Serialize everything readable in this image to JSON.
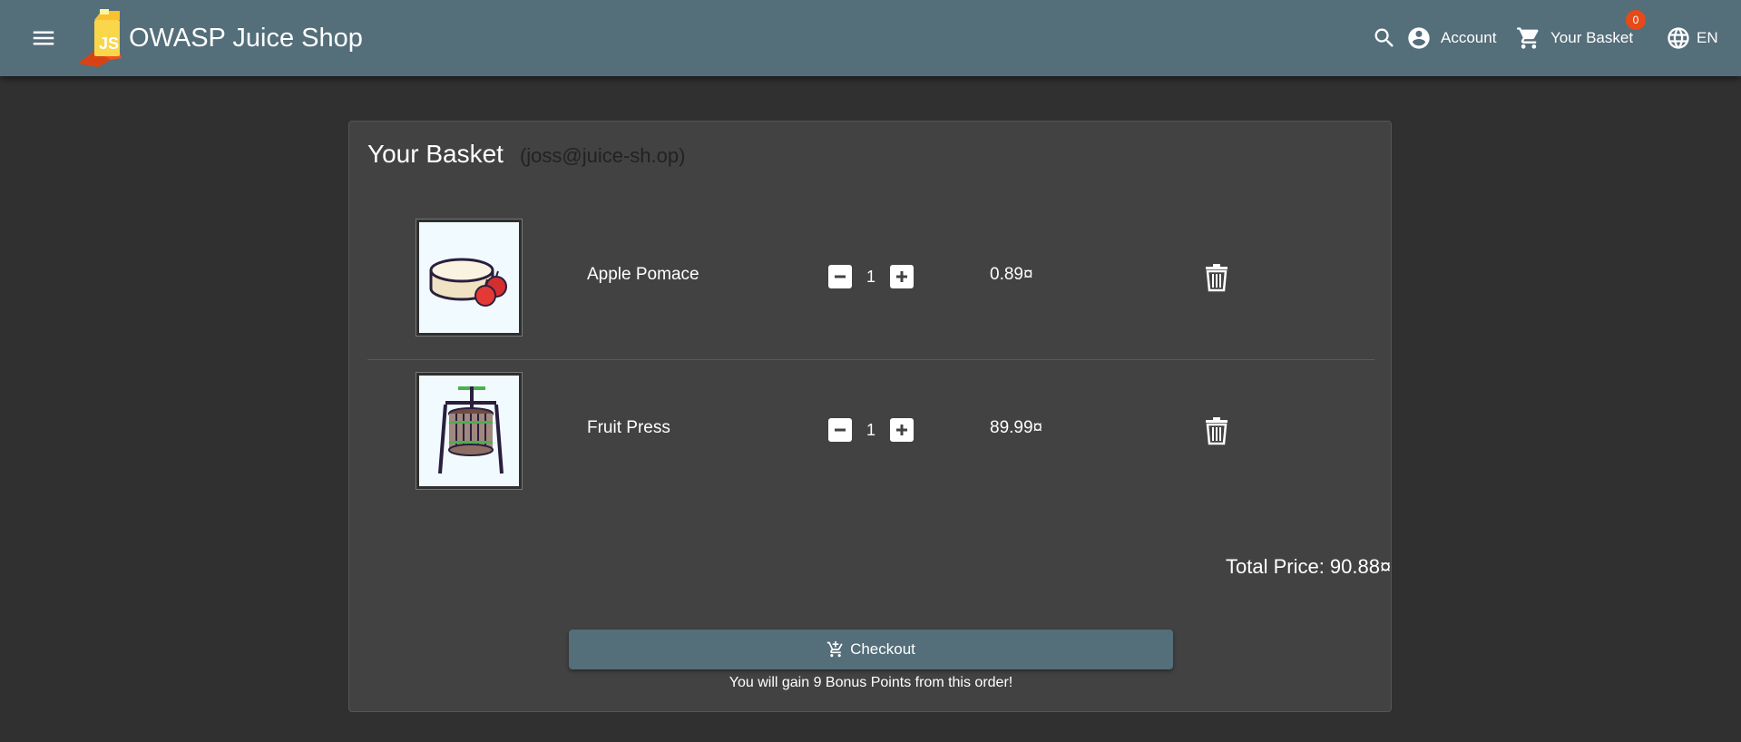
{
  "header": {
    "title": "OWASP Juice Shop",
    "account_label": "Account",
    "basket_label": "Your Basket",
    "basket_count": "0",
    "language": "EN",
    "toolbar_color": "#546e7a",
    "badge_color": "#e64a19"
  },
  "basket": {
    "title": "Your Basket",
    "user_email": "(joss@juice-sh.op)",
    "items": [
      {
        "name": "Apple Pomace",
        "quantity": "1",
        "price": "0.89¤",
        "image_icon": "apple-pomace-icon"
      },
      {
        "name": "Fruit Press",
        "quantity": "1",
        "price": "89.99¤",
        "image_icon": "fruit-press-icon"
      }
    ],
    "total_price": "Total Price: 90.88¤",
    "checkout_label": "Checkout",
    "bonus_text": "You will gain 9 Bonus Points from this order!"
  }
}
